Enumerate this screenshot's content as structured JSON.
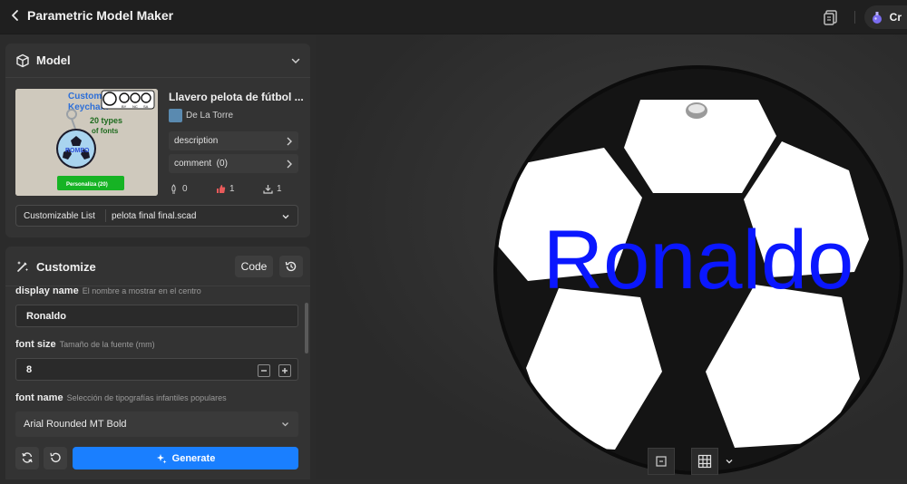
{
  "topbar": {
    "title": "Parametric Model Maker",
    "create_label": "Cr"
  },
  "model_panel": {
    "title": "Model",
    "model_name": "Llavero pelota de fútbol ...",
    "author": "De La Torre",
    "thumbnail": {
      "heading_line1": "Custom",
      "heading_line2": "Keychain",
      "license": [
        "BY",
        "NC",
        "SA"
      ],
      "types_line1": "20 types",
      "types_line2": "of fonts",
      "personalize": "Personaliza (20)",
      "ball_text": "ROMEO"
    },
    "buttons": {
      "description": "description",
      "comment": "comment  (0)"
    },
    "stats": {
      "boosts": "0",
      "likes": "1",
      "downloads": "1"
    },
    "customizable_list": {
      "label": "Customizable List",
      "value": "pelota final final.scad"
    }
  },
  "customize_panel": {
    "title": "Customize",
    "code_label": "Code",
    "params": [
      {
        "label": "display name",
        "desc": "El nombre a mostrar en el centro",
        "value": "Ronaldo"
      },
      {
        "label": "font size",
        "desc": "Tamaño de la fuente (mm)",
        "value": "8"
      },
      {
        "label": "font name",
        "desc": "Selección de tipografías infantiles populares",
        "value": "Arial Rounded MT Bold"
      }
    ],
    "generate_label": "Generate"
  },
  "viewport": {
    "render_text": "Ronaldo",
    "text_color": "#0a17ff",
    "ball_black": "#111111",
    "ball_white": "#ffffff"
  },
  "colors": {
    "accent": "#1a7fff",
    "panel_bg": "#333333",
    "app_bg": "#2b2b2b",
    "topbar_bg": "#1f1f1f"
  }
}
